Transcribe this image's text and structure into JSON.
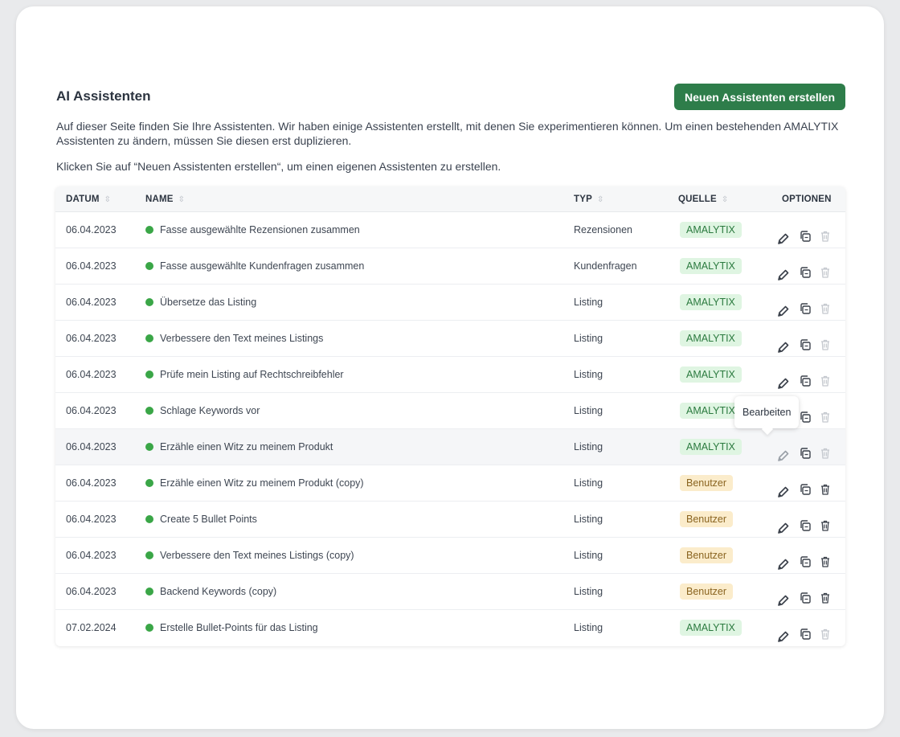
{
  "page": {
    "title": "AI Assistenten",
    "create_button": "Neuen Assistenten erstellen",
    "intro_line1": "Auf dieser Seite finden Sie Ihre Assistenten. Wir haben einige Assistenten erstellt, mit denen Sie experimentieren können. Um einen bestehenden AMALYTIX Assistenten zu ändern, müssen Sie diesen erst duplizieren.",
    "intro_line2": "Klicken Sie auf “Neuen Assistenten erstellen“, um einen eigenen Assistenten zu erstellen.",
    "tooltip": "Bearbeiten"
  },
  "colors": {
    "primary_button": "#2e7d4a",
    "status_active": "#3aa647",
    "badge_amalytix_bg": "#dff5e2",
    "badge_user_bg": "#fbeccb"
  },
  "table": {
    "headers": {
      "date": "DATUM",
      "name": "NAME",
      "type": "TYP",
      "source": "QUELLE",
      "options": "OPTIONEN"
    },
    "sort_icon": "⇳",
    "icons": [
      "pencil-icon",
      "copy-icon",
      "trash-icon"
    ],
    "rows": [
      {
        "date": "06.04.2023",
        "name": "Fasse ausgewählte Rezensionen zusammen",
        "type": "Rezensionen",
        "source": "AMALYTIX",
        "source_kind": "amalytix",
        "delete_enabled": false
      },
      {
        "date": "06.04.2023",
        "name": "Fasse ausgewählte Kundenfragen zusammen",
        "type": "Kundenfragen",
        "source": "AMALYTIX",
        "source_kind": "amalytix",
        "delete_enabled": false
      },
      {
        "date": "06.04.2023",
        "name": "Übersetze das Listing",
        "type": "Listing",
        "source": "AMALYTIX",
        "source_kind": "amalytix",
        "delete_enabled": false
      },
      {
        "date": "06.04.2023",
        "name": "Verbessere den Text meines Listings",
        "type": "Listing",
        "source": "AMALYTIX",
        "source_kind": "amalytix",
        "delete_enabled": false
      },
      {
        "date": "06.04.2023",
        "name": "Prüfe mein Listing auf Rechtschreibfehler",
        "type": "Listing",
        "source": "AMALYTIX",
        "source_kind": "amalytix",
        "delete_enabled": false
      },
      {
        "date": "06.04.2023",
        "name": "Schlage Keywords vor",
        "type": "Listing",
        "source": "AMALYTIX",
        "source_kind": "amalytix",
        "delete_enabled": false
      },
      {
        "date": "06.04.2023",
        "name": "Erzähle einen Witz zu meinem Produkt",
        "type": "Listing",
        "source": "AMALYTIX",
        "source_kind": "amalytix",
        "delete_enabled": false
      },
      {
        "date": "06.04.2023",
        "name": "Erzähle einen Witz zu meinem Produkt (copy)",
        "type": "Listing",
        "source": "Benutzer",
        "source_kind": "user",
        "delete_enabled": true
      },
      {
        "date": "06.04.2023",
        "name": "Create 5 Bullet Points",
        "type": "Listing",
        "source": "Benutzer",
        "source_kind": "user",
        "delete_enabled": true
      },
      {
        "date": "06.04.2023",
        "name": "Verbessere den Text meines Listings (copy)",
        "type": "Listing",
        "source": "Benutzer",
        "source_kind": "user",
        "delete_enabled": true
      },
      {
        "date": "06.04.2023",
        "name": "Backend Keywords (copy)",
        "type": "Listing",
        "source": "Benutzer",
        "source_kind": "user",
        "delete_enabled": true
      },
      {
        "date": "07.02.2024",
        "name": "Erstelle Bullet-Points für das Listing",
        "type": "Listing",
        "source": "AMALYTIX",
        "source_kind": "amalytix",
        "delete_enabled": false
      }
    ]
  }
}
